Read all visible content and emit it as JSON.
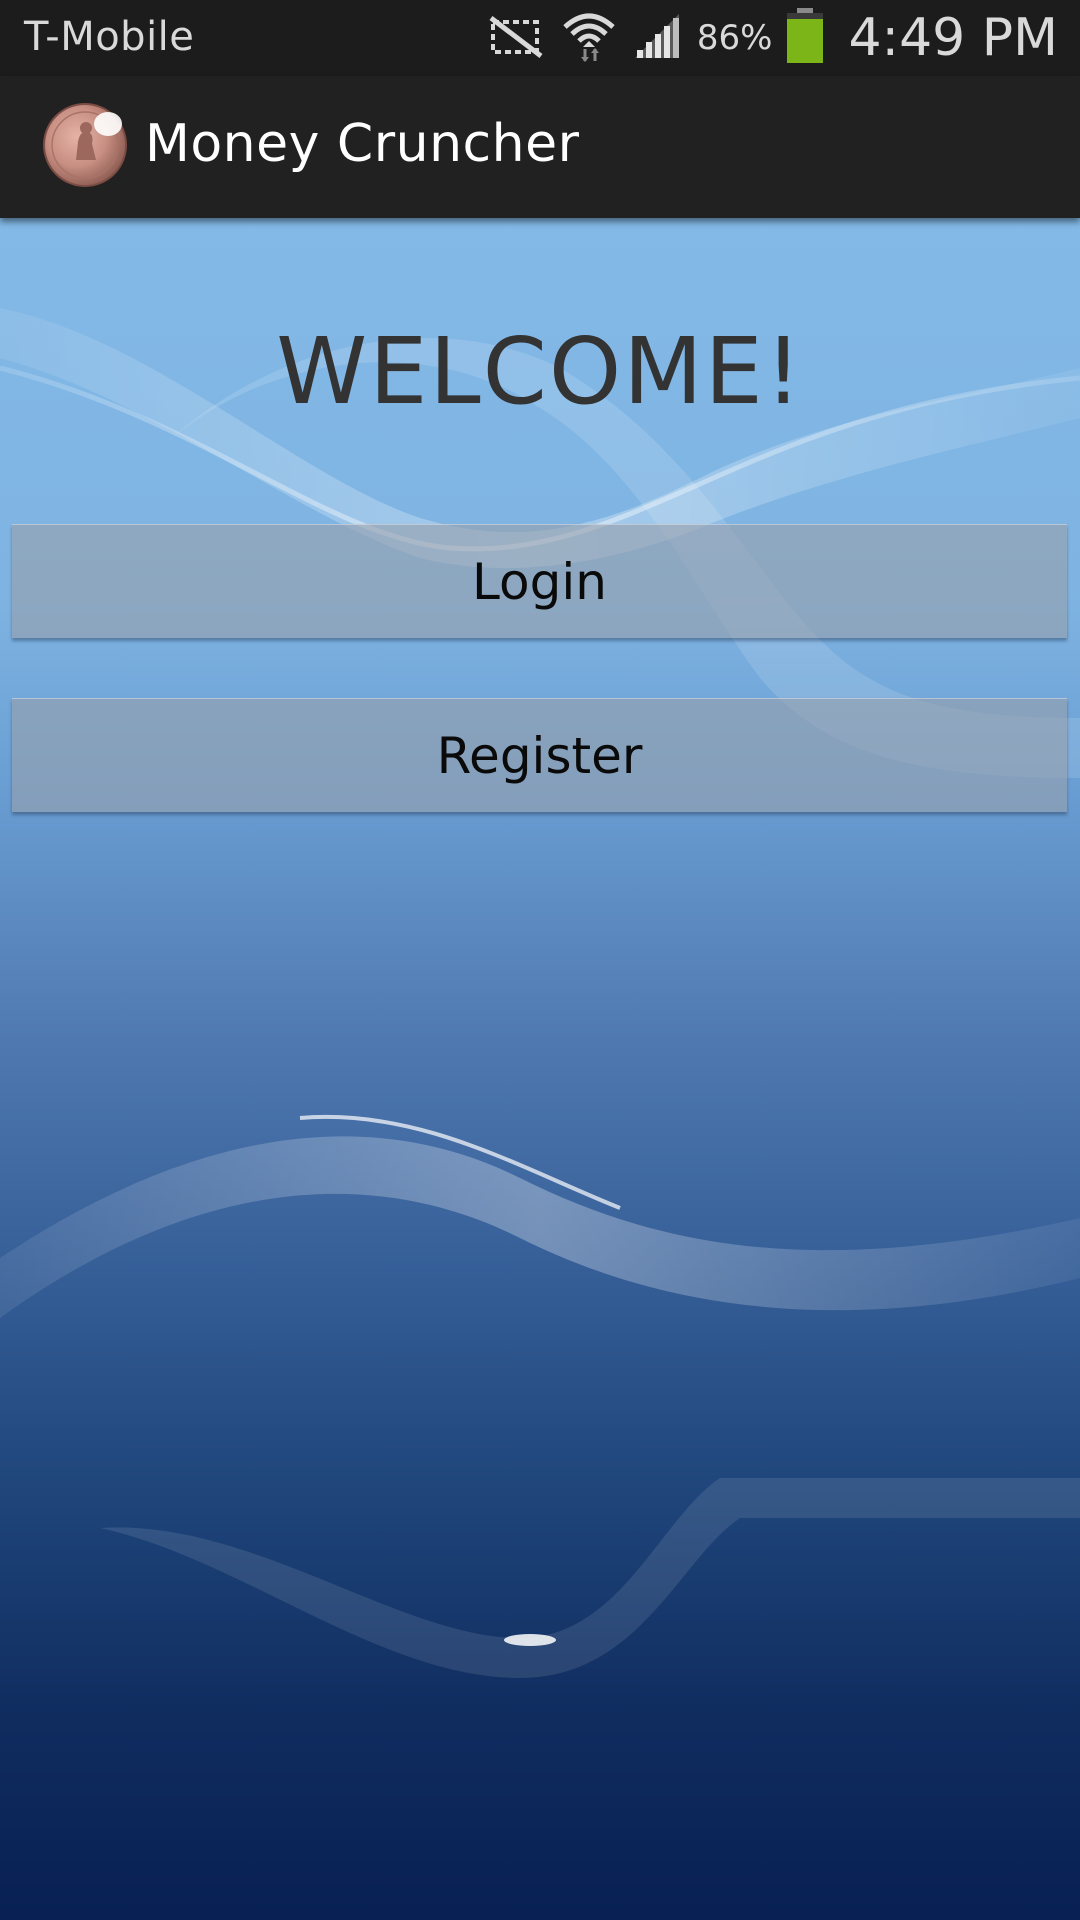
{
  "status_bar": {
    "carrier": "T-Mobile",
    "battery_percent": "86%",
    "time": "4:49 PM",
    "icons": [
      "no-signal-vibrate-icon",
      "wifi-icon",
      "cell-signal-icon",
      "battery-icon"
    ],
    "battery_color": "#7cb518"
  },
  "action_bar": {
    "title": "Money Cruncher",
    "icon": "coin-logo-icon"
  },
  "main": {
    "heading": "WELCOME!",
    "login_label": "Login",
    "register_label": "Register"
  },
  "colors": {
    "status_bar_bg": "#1c1c1c",
    "action_bar_bg": "#212121",
    "background_top": "#83b9e7",
    "background_bottom": "#082054",
    "heading_text": "#333333"
  }
}
